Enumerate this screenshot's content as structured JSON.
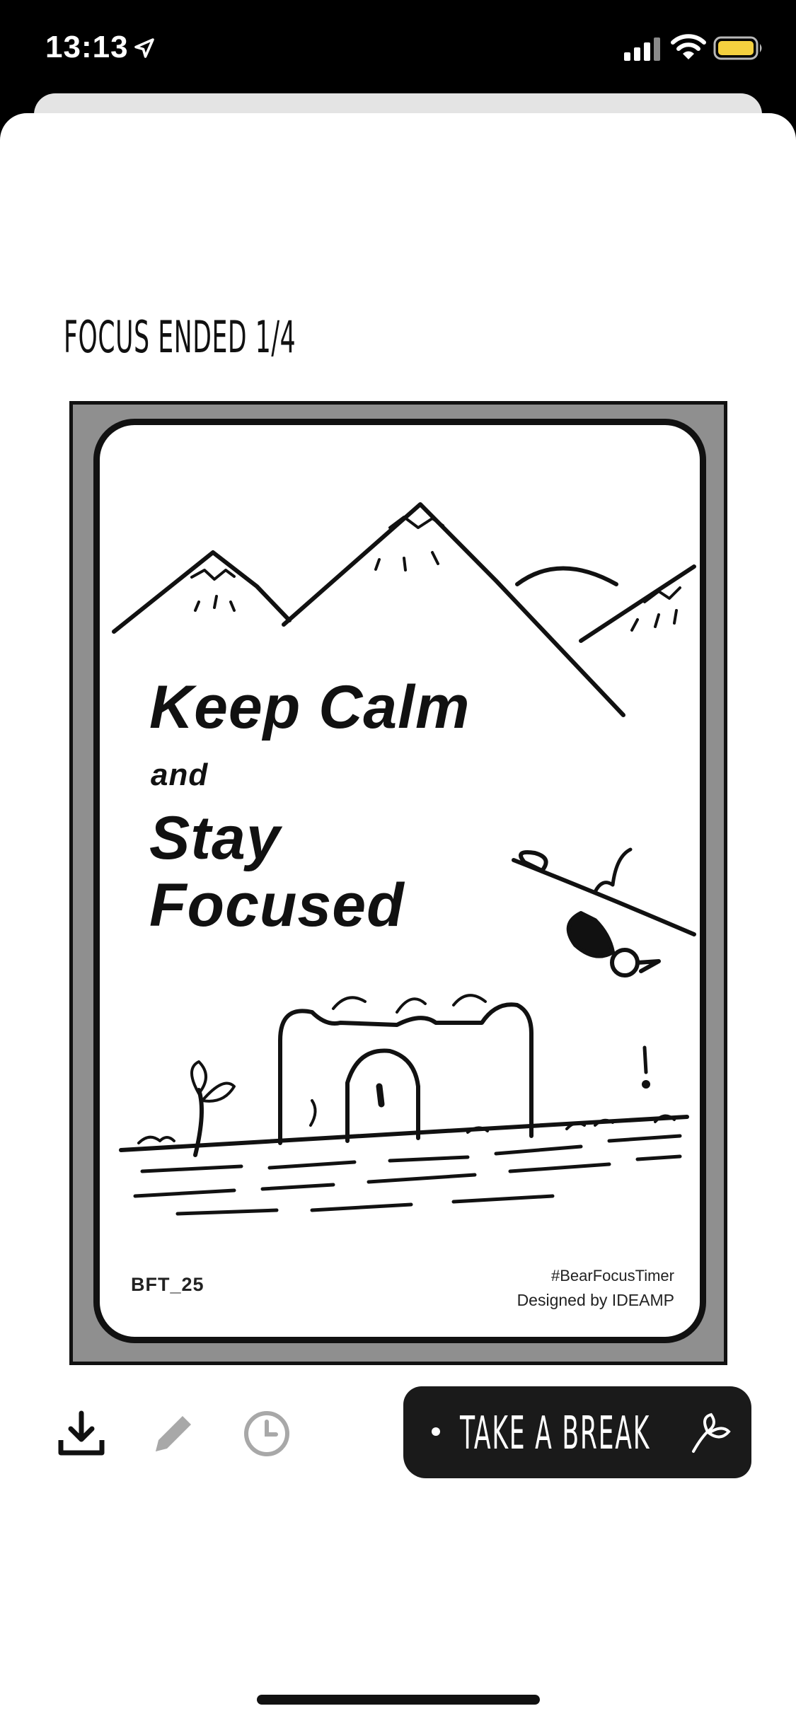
{
  "status_bar": {
    "time": "13:13",
    "icons": [
      "location-arrow-icon",
      "cellular-signal-icon",
      "wifi-icon",
      "battery-icon"
    ],
    "battery_color": "#f4d03f"
  },
  "sheet": {
    "title": "FOCUS ENDED 1/4"
  },
  "poster": {
    "headline_1": "Keep Calm",
    "headline_2": "and",
    "headline_3": "Stay",
    "headline_4": "Focused",
    "code": "BFT_25",
    "hashtag": "#BearFocusTimer",
    "credit": "Designed by IDEAMP"
  },
  "toolbar": {
    "icons": [
      "download-icon",
      "pencil-icon",
      "clock-icon"
    ],
    "break_label": "TAKE A BREAK"
  }
}
